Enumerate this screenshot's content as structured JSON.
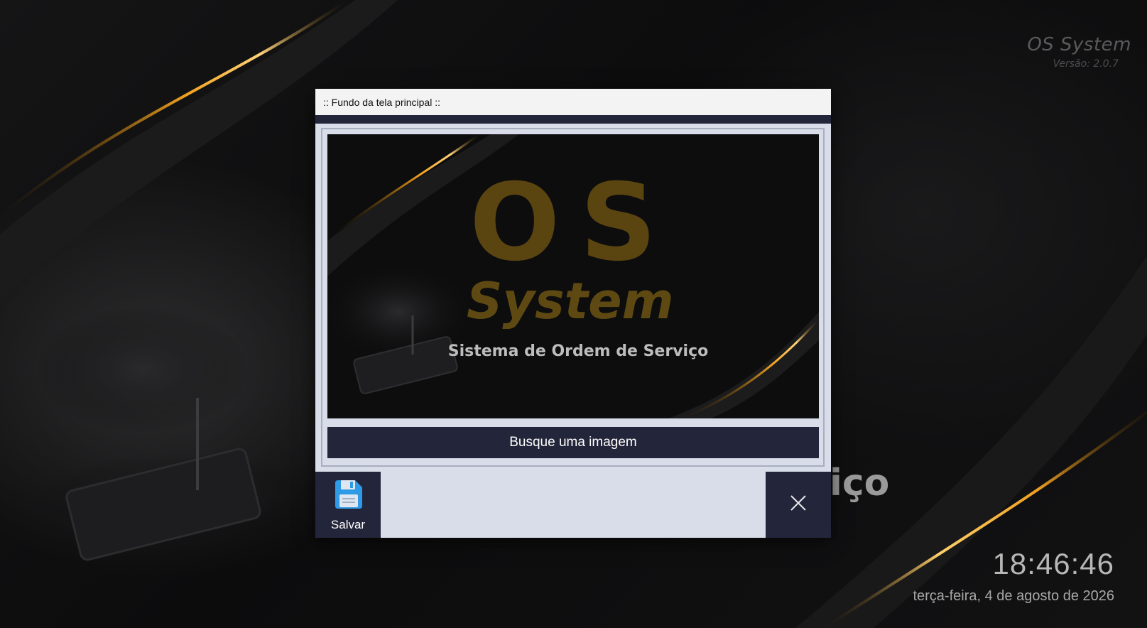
{
  "desktop": {
    "brand_name": "OS System",
    "version": "Versão: 2.0.7",
    "background_text_fragment": "iço",
    "clock": "18:46:46",
    "date": "terça-feira, 4 de agosto de 2026"
  },
  "dialog": {
    "title": ":: Fundo da tela principal ::",
    "preview": {
      "logo_top": "OS",
      "logo_bottom": "System",
      "tagline": "Sistema de Ordem de Serviço"
    },
    "browse_label": "Busque uma imagem",
    "save_label": "Salvar"
  },
  "colors": {
    "dialog_dark": "#23253a",
    "dialog_light": "#d8dde9",
    "gold": "#f0a020",
    "save_icon_blue": "#2f9be6"
  },
  "icons": {
    "save": "floppy-disk-icon",
    "close": "close-icon"
  }
}
